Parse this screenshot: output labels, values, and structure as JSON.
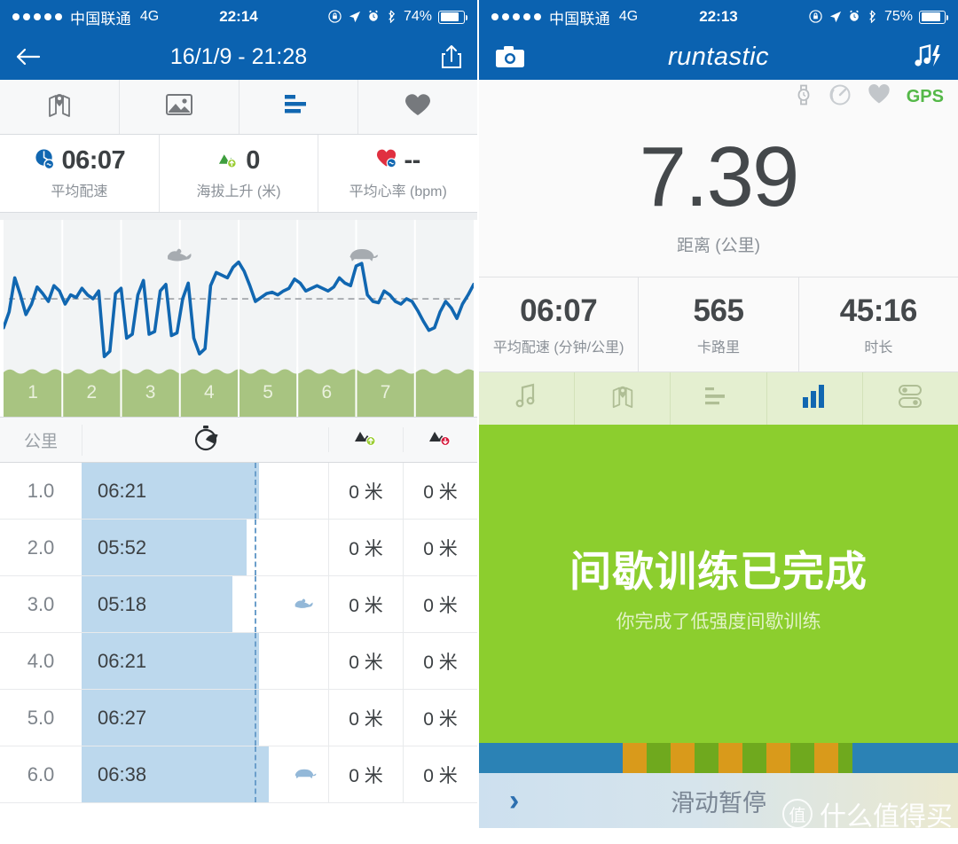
{
  "left": {
    "status_bar": {
      "signal_dots": 5,
      "carrier": "中国联通",
      "network": "4G",
      "time": "22:14",
      "battery_percent": "74%",
      "icons": [
        "rotation-lock-icon",
        "location-arrow-icon",
        "alarm-clock-icon",
        "bluetooth-icon"
      ]
    },
    "nav": {
      "back_label": "←",
      "title": "16/1/9 - 21:28",
      "share_label": "share-icon"
    },
    "tabs": [
      {
        "name": "map-tab",
        "icon": "map-pin-icon",
        "active": false
      },
      {
        "name": "photos-tab",
        "icon": "image-icon",
        "active": false
      },
      {
        "name": "splits-tab",
        "icon": "bar-list-icon",
        "active": true
      },
      {
        "name": "heart-tab",
        "icon": "heart-icon",
        "active": false
      }
    ],
    "summary": [
      {
        "icon": "pace-icon",
        "value": "06:07",
        "label": "平均配速"
      },
      {
        "icon": "elevation-gain-icon",
        "value": "0",
        "label": "海拔上升 (米)"
      },
      {
        "icon": "heart-rate-icon",
        "value": "--",
        "label": "平均心率 (bpm)"
      }
    ],
    "table": {
      "headers": {
        "km": "公里",
        "pace": "stopwatch-icon",
        "elev_gain": "elevation-up-icon",
        "elev_loss": "elevation-down-icon"
      },
      "rows": [
        {
          "km": "1.0",
          "pace": "06:21",
          "bar_pct": 72,
          "critter": "",
          "gain": "0 米",
          "loss": "0 米"
        },
        {
          "km": "2.0",
          "pace": "05:52",
          "bar_pct": 67,
          "critter": "",
          "gain": "0 米",
          "loss": "0 米"
        },
        {
          "km": "3.0",
          "pace": "05:18",
          "bar_pct": 61,
          "critter": "rabbit-icon",
          "gain": "0 米",
          "loss": "0 米"
        },
        {
          "km": "4.0",
          "pace": "06:21",
          "bar_pct": 72,
          "critter": "",
          "gain": "0 米",
          "loss": "0 米"
        },
        {
          "km": "5.0",
          "pace": "06:27",
          "bar_pct": 72,
          "critter": "",
          "gain": "0 米",
          "loss": "0 米"
        },
        {
          "km": "6.0",
          "pace": "06:38",
          "bar_pct": 76,
          "critter": "turtle-icon",
          "gain": "0 米",
          "loss": "0 米"
        }
      ],
      "avg_line_pct": 70
    },
    "chart_data": {
      "type": "line",
      "title": "",
      "xlabel": "公里",
      "ylabel": "配速",
      "x": [
        1,
        2,
        3,
        4,
        5,
        6,
        7
      ],
      "tick_labels": [
        "1",
        "2",
        "3",
        "4",
        "5",
        "6",
        "7"
      ],
      "average_line": 0.52,
      "grid": true,
      "legend": "none",
      "markers": [
        {
          "type": "rabbit-icon",
          "x": 3.0
        },
        {
          "type": "turtle-icon",
          "x": 6.1
        }
      ],
      "series": [
        {
          "name": "配速",
          "color": "#1167B1",
          "values": [
            0.3,
            0.42,
            0.68,
            0.55,
            0.4,
            0.48,
            0.61,
            0.56,
            0.5,
            0.62,
            0.58,
            0.48,
            0.55,
            0.53,
            0.6,
            0.55,
            0.52,
            0.58,
            0.08,
            0.12,
            0.56,
            0.6,
            0.22,
            0.25,
            0.55,
            0.66,
            0.25,
            0.27,
            0.58,
            0.63,
            0.24,
            0.26,
            0.52,
            0.64,
            0.22,
            0.1,
            0.14,
            0.62,
            0.72,
            0.7,
            0.68,
            0.76,
            0.8,
            0.73,
            0.62,
            0.5,
            0.53,
            0.56,
            0.57,
            0.55,
            0.58,
            0.6,
            0.67,
            0.64,
            0.58,
            0.6,
            0.62,
            0.6,
            0.58,
            0.61,
            0.68,
            0.64,
            0.62,
            0.77,
            0.79,
            0.55,
            0.5,
            0.49,
            0.58,
            0.55,
            0.5,
            0.48,
            0.52,
            0.5,
            0.43,
            0.35,
            0.28,
            0.3,
            0.42,
            0.5,
            0.45,
            0.37,
            0.48,
            0.55,
            0.63
          ]
        }
      ]
    }
  },
  "right": {
    "status_bar": {
      "signal_dots": 5,
      "carrier": "中国联通",
      "network": "4G",
      "time": "22:13",
      "battery_percent": "75%",
      "icons": [
        "rotation-lock-icon",
        "location-arrow-icon",
        "alarm-clock-icon",
        "bluetooth-icon"
      ]
    },
    "nav": {
      "camera_label": "camera-icon",
      "logo": "runtastic",
      "music_label": "music-flash-icon"
    },
    "sensors": {
      "items": [
        "watch-icon",
        "speed-sensor-icon",
        "heart-icon"
      ],
      "gps": "GPS",
      "gps_color": "#54B848"
    },
    "big_stat": {
      "value": "7.39",
      "label": "距离 (公里)"
    },
    "stats": [
      {
        "value": "06:07",
        "label": "平均配速 (分钟/公里)"
      },
      {
        "value": "565",
        "label": "卡路里"
      },
      {
        "value": "45:16",
        "label": "时长"
      }
    ],
    "tabs": [
      {
        "name": "music-tab",
        "icon": "music-note-icon",
        "active": false
      },
      {
        "name": "map-tab",
        "icon": "map-pin-icon",
        "active": false
      },
      {
        "name": "list-tab",
        "icon": "bar-list-icon",
        "active": false
      },
      {
        "name": "stats-tab",
        "icon": "bar-chart-icon",
        "active": true
      },
      {
        "name": "settings-tab",
        "icon": "toggles-icon",
        "active": false
      }
    ],
    "banner": {
      "title": "间歇训练已完成",
      "subtitle": "你完成了低强度间歇训练",
      "bg_color": "#8CCE2E"
    },
    "interval_bar": {
      "segments": [
        {
          "color": "#2B82B5",
          "pct": 30
        },
        {
          "color": "#D99A1B",
          "pct": 5
        },
        {
          "color": "#6FA91E",
          "pct": 5
        },
        {
          "color": "#D99A1B",
          "pct": 5
        },
        {
          "color": "#6FA91E",
          "pct": 5
        },
        {
          "color": "#D99A1B",
          "pct": 5
        },
        {
          "color": "#6FA91E",
          "pct": 5
        },
        {
          "color": "#D99A1B",
          "pct": 5
        },
        {
          "color": "#6FA91E",
          "pct": 5
        },
        {
          "color": "#D99A1B",
          "pct": 5
        },
        {
          "color": "#6FA91E",
          "pct": 3
        },
        {
          "color": "#2B82B5",
          "pct": 22
        }
      ]
    },
    "pause": {
      "chevron": "›",
      "label": "滑动暂停"
    },
    "watermark": {
      "mark": "值",
      "text": "什么值得买"
    }
  }
}
